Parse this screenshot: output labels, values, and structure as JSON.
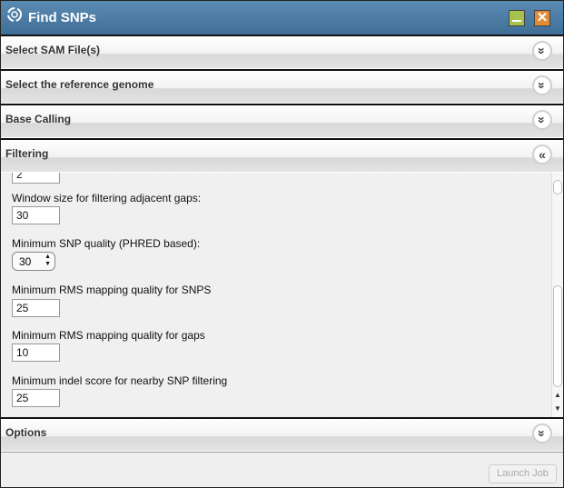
{
  "window": {
    "title": "Find SNPs",
    "title_icon": "swirl-logo-icon",
    "minimize_icon": "minimize-icon",
    "close_icon": "close-icon"
  },
  "sections": {
    "sam": {
      "title": "Select SAM File(s)",
      "state": "collapsed"
    },
    "reference": {
      "title": "Select the reference genome",
      "state": "collapsed"
    },
    "base_calling": {
      "title": "Base Calling",
      "state": "collapsed"
    },
    "filtering": {
      "title": "Filtering",
      "state": "expanded"
    },
    "options": {
      "title": "Options",
      "state": "collapsed"
    }
  },
  "filtering": {
    "partial_value": "2",
    "fields": [
      {
        "label": "Window size for filtering adjacent gaps:",
        "value": "30",
        "control": "textbox"
      },
      {
        "label": "Minimum SNP quality (PHRED based):",
        "value": "30",
        "control": "spinner"
      },
      {
        "label": "Minimum RMS mapping quality for SNPS",
        "value": "25",
        "control": "textbox"
      },
      {
        "label": "Minimum RMS mapping quality for gaps",
        "value": "10",
        "control": "textbox"
      },
      {
        "label": "Minimum indel score for nearby SNP filtering",
        "value": "25",
        "control": "textbox"
      }
    ]
  },
  "footer": {
    "launch_label": "Launch Job",
    "launch_enabled": false
  },
  "colors": {
    "titlebar": "#4a7aa2",
    "minimize": "#a7c14e",
    "close": "#e28b38"
  }
}
